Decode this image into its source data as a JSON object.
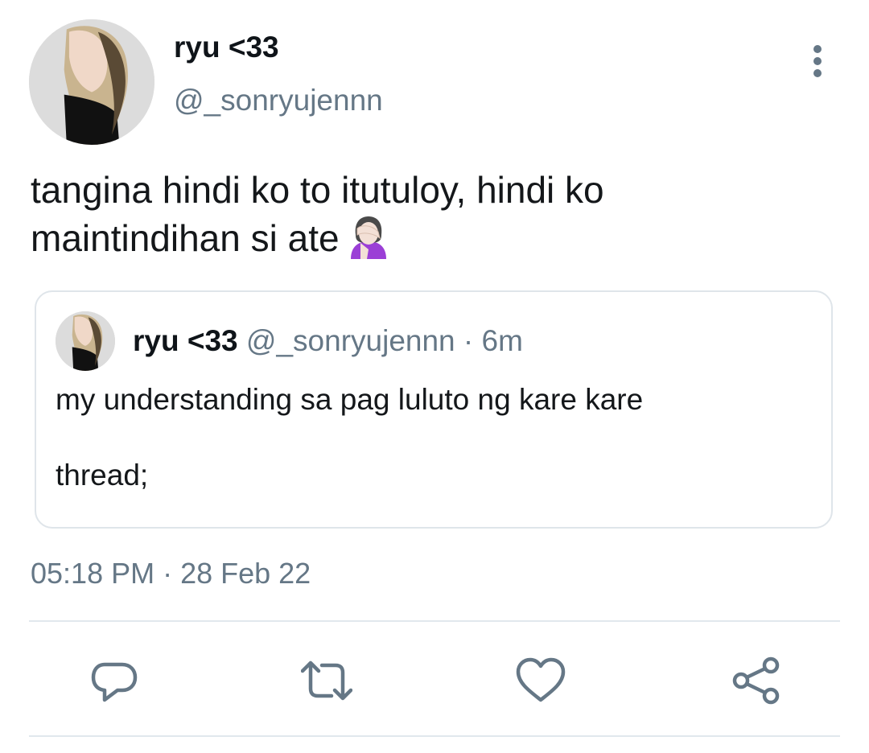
{
  "tweet": {
    "display_name": "ryu <33",
    "handle": "@_sonryujennn",
    "text_line1": "tangina hindi ko to itutuloy, hindi ko",
    "text_line2": "maintindihan si ate",
    "emoji": "woman-facepalming-icon",
    "timestamp": "05:18 PM · 28 Feb 22"
  },
  "quoted_tweet": {
    "display_name": "ryu <33",
    "meta": " @_sonryujennn · 6m",
    "text_line1": "my understanding sa pag luluto ng kare kare",
    "text_line2": "thread;"
  },
  "actions": [
    {
      "icon": "reply-icon"
    },
    {
      "icon": "retweet-icon"
    },
    {
      "icon": "like-icon"
    },
    {
      "icon": "share-icon"
    }
  ],
  "colors": {
    "primary_text": "#0f1419",
    "secondary_text": "#657786",
    "border": "#dfe5ea",
    "icon": "#657786"
  }
}
